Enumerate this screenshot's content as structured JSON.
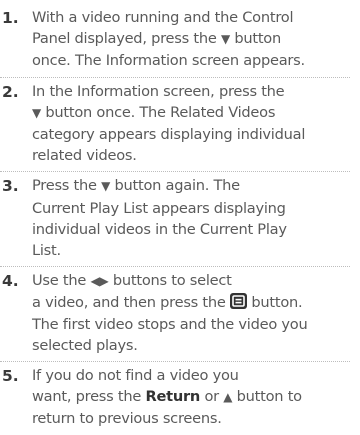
{
  "steps": [
    {
      "number": "1.",
      "lines": [
        "With a video running and the Control",
        [
          "Panel displayed, press the ",
          {
            "icon": "down-arrow-icon",
            "text": "▼"
          },
          " button"
        ],
        "once. The Information screen appears."
      ]
    },
    {
      "number": "2.",
      "lines": [
        "In the Information screen, press the",
        [
          {
            "icon": "down-arrow-icon",
            "text": "▼"
          },
          " button once. The Related Videos"
        ],
        "category appears displaying individual",
        "related videos."
      ]
    },
    {
      "number": "3.",
      "lines": [
        [
          "Press the ",
          {
            "icon": "down-arrow-icon",
            "text": "▼"
          },
          " button again. The"
        ],
        "Current Play List appears displaying",
        "individual videos in the Current Play",
        "List."
      ]
    },
    {
      "number": "4.",
      "lines": [
        [
          "Use the ",
          {
            "icon": "left-right-arrows-icon",
            "text": "◀▶"
          },
          " buttons to select"
        ],
        [
          "a video, and then press the ",
          {
            "icon": "enter-icon",
            "text": ""
          },
          " button."
        ],
        "The first video stops and the video you",
        "selected plays."
      ]
    },
    {
      "number": "5.",
      "lines": [
        "If you do not find a video you",
        [
          "want, press the ",
          {
            "bold": "Return"
          },
          " or ",
          {
            "icon": "up-arrow-icon",
            "text": "▲"
          },
          " button to"
        ],
        "return to previous screens."
      ]
    }
  ]
}
